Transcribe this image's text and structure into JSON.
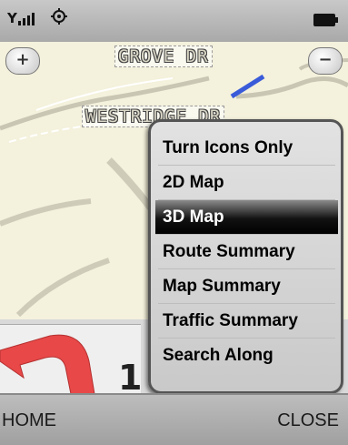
{
  "status_bar": {
    "signal_icon": "signal-strength-icon",
    "gps_icon": "gps-icon",
    "battery_icon": "battery-icon"
  },
  "map": {
    "streets": [
      "GROVE DR",
      "WESTRIDGE DR"
    ],
    "zoom_in_label": "+",
    "zoom_out_label": "−",
    "next_turn_distance": "1"
  },
  "menu": {
    "items": [
      "Turn Icons Only",
      "2D Map",
      "3D Map",
      "Route Summary",
      "Map Summary",
      "Traffic Summary",
      "Search Along"
    ],
    "selected_item": "3D Map"
  },
  "softkeys": {
    "left": "HOME",
    "right": "CLOSE"
  },
  "colors": {
    "menu_selected_bg": "#000000",
    "route_arrow": "#e84848",
    "route_line": "#3a5bd9"
  }
}
